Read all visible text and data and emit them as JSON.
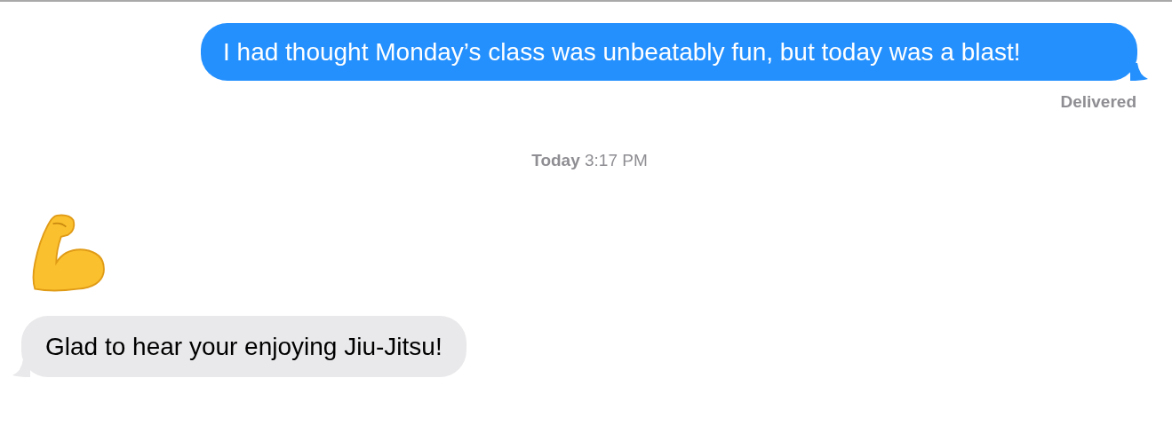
{
  "messages": [
    {
      "kind": "sent",
      "text": "I had thought Monday’s class was unbeatably fun, but today was a blast!",
      "status": "Delivered"
    },
    {
      "kind": "timestamp",
      "text": "**Today** 3:17 PM"
    },
    {
      "kind": "emoji"
    },
    {
      "kind": "received",
      "text": "Glad to hear your enjoying Jiu-Jitsu!"
    }
  ]
}
